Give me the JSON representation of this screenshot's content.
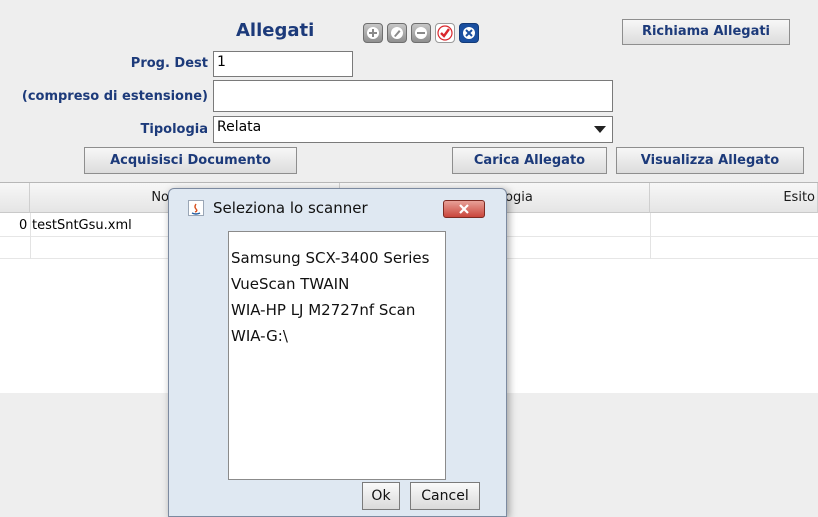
{
  "form": {
    "title": "Allegati",
    "richiama_button": "Richiama Allegati",
    "prog_dest_label": "Prog. Dest",
    "prog_dest_value": "1",
    "estensione_label": "(compreso di estensione)",
    "estensione_value": "",
    "tipologia_label": "Tipologia",
    "tipologia_value": "Relata",
    "acquisisci_button": "Acquisisci Documento",
    "carica_button": "Carica Allegato",
    "visualizza_button": "Visualizza Allegato",
    "toolbar_icons": [
      "add-icon",
      "edit-icon",
      "remove-icon",
      "check-icon",
      "cancel-icon"
    ]
  },
  "table": {
    "columns": [
      "No",
      "ogia",
      "Esito"
    ],
    "rows": [
      {
        "index": "0",
        "name": "testSntGsu.xml"
      }
    ]
  },
  "dialog": {
    "title": "Seleziona lo scanner",
    "scanners": [
      "Samsung SCX-3400 Series",
      "VueScan TWAIN",
      "WIA-HP LJ M2727nf Scan",
      "WIA-G:\\"
    ],
    "ok_label": "Ok",
    "cancel_label": "Cancel"
  },
  "colors": {
    "label_blue": "#1c3a7a",
    "check_red": "#d9262c",
    "cancel_blue": "#1a4fa0",
    "close_red": "#c9453b"
  }
}
